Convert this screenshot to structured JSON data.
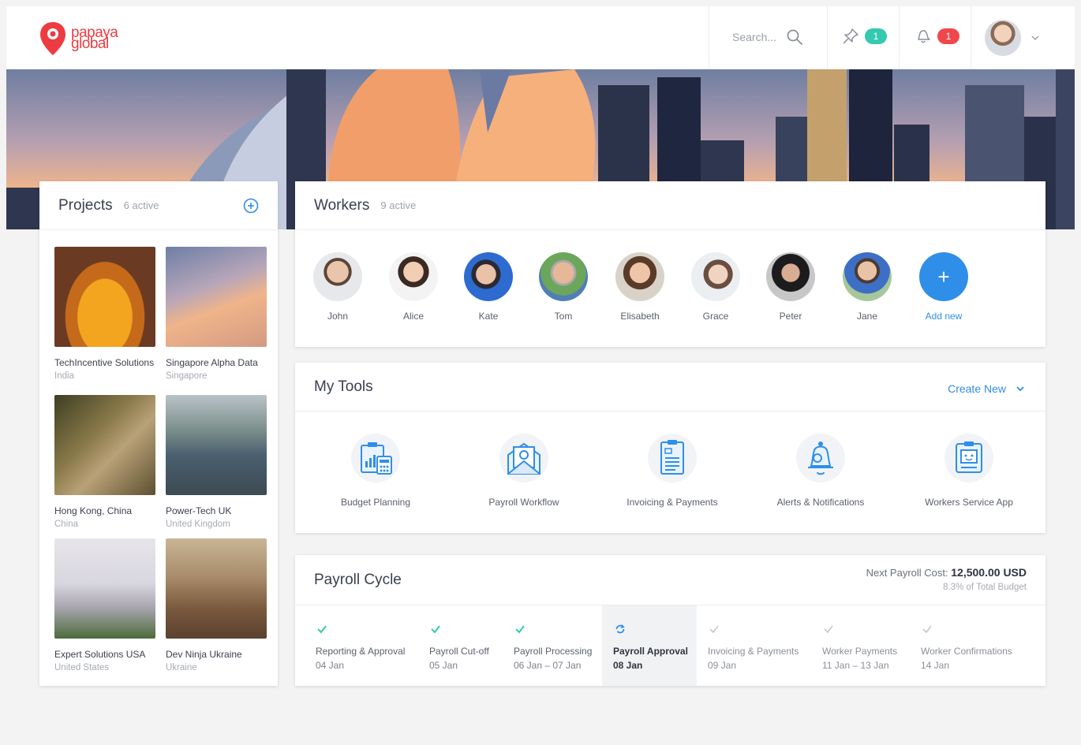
{
  "brand": {
    "line1": "papaya",
    "line2": "global",
    "color": "#ee3b41"
  },
  "header": {
    "search_placeholder": "Search...",
    "pins_count": "1",
    "notifications_count": "1"
  },
  "projects": {
    "title": "Projects",
    "active": "6 active",
    "items": [
      {
        "name": "TechIncentive Solutions",
        "location": "India"
      },
      {
        "name": "Singapore Alpha Data",
        "location": "Singapore"
      },
      {
        "name": "Hong Kong, China",
        "location": "China"
      },
      {
        "name": "Power-Tech UK",
        "location": "United Kingdom"
      },
      {
        "name": "Expert Solutions USA",
        "location": "United States"
      },
      {
        "name": "Dev Ninja Ukraine",
        "location": "Ukraine"
      }
    ]
  },
  "workers": {
    "title": "Workers",
    "active": "9 active",
    "people": [
      "John",
      "Alice",
      "Kate",
      "Tom",
      "Elisabeth",
      "Grace",
      "Peter",
      "Jane"
    ],
    "add_label": "Add new"
  },
  "tools": {
    "title": "My Tools",
    "create_new": "Create New",
    "items": [
      "Budget Planning",
      "Payroll Workflow",
      "Invoicing & Payments",
      "Alerts & Notifications",
      "Workers Service App"
    ]
  },
  "payroll": {
    "title": "Payroll Cycle",
    "cost_label": "Next Payroll Cost:",
    "cost_value": "12,500.00 USD",
    "budget_note": "8.3% of Total Budget",
    "steps": [
      {
        "name": "Reporting & Approval",
        "date": "04 Jan",
        "state": "done"
      },
      {
        "name": "Payroll Cut-off",
        "date": "05 Jan",
        "state": "done"
      },
      {
        "name": "Payroll Processing",
        "date": "06 Jan – 07 Jan",
        "state": "done"
      },
      {
        "name": "Payroll Approval",
        "date": "08 Jan",
        "state": "active"
      },
      {
        "name": "Invoicing & Payments",
        "date": "09 Jan",
        "state": "todo"
      },
      {
        "name": "Worker Payments",
        "date": "11 Jan – 13 Jan",
        "state": "todo"
      },
      {
        "name": "Worker Confirmations",
        "date": "14 Jan",
        "state": "todo"
      }
    ]
  },
  "colors": {
    "accent_blue": "#2f8fe8",
    "teal": "#35c9b0",
    "red": "#f0474c"
  }
}
